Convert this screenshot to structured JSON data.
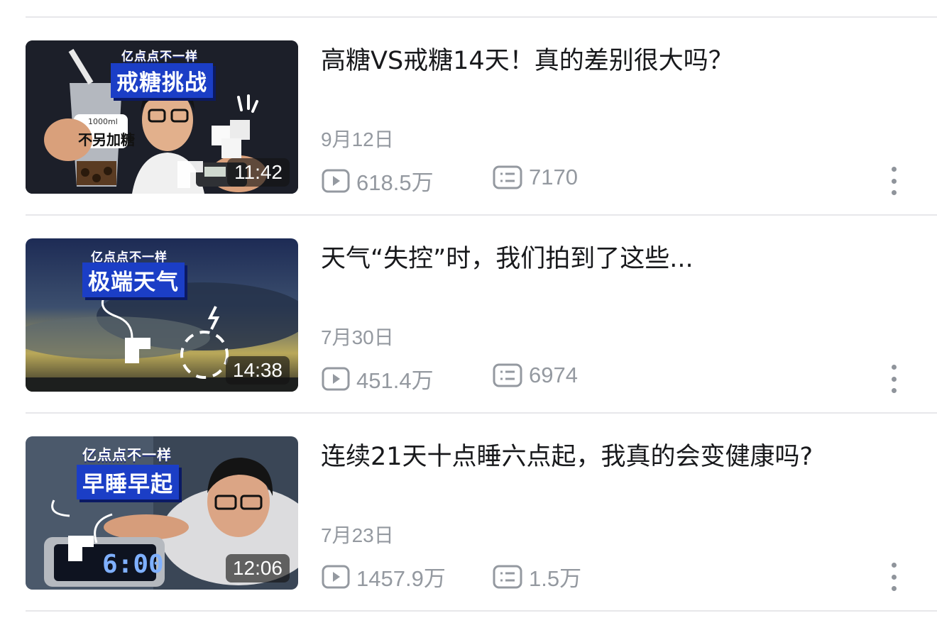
{
  "videos": [
    {
      "title": "高糖VS戒糖14天！真的差别很大吗？",
      "date": "9月12日",
      "views": "618.5万",
      "comments": "7170",
      "duration": "11:42",
      "thumb_badge_top": "亿点点不一样",
      "thumb_badge_main": "戒糖挑战",
      "thumb_cup_text": "不另加糖",
      "thumb_cup_volume": "1000ml"
    },
    {
      "title": "天气“失控”时，我们拍到了这些...",
      "date": "7月30日",
      "views": "451.4万",
      "comments": "6974",
      "duration": "14:38",
      "thumb_badge_top": "亿点点不一样",
      "thumb_badge_main": "极端天气"
    },
    {
      "title": "连续21天十点睡六点起，我真的会变健康吗?",
      "date": "7月23日",
      "views": "1457.9万",
      "comments": "1.5万",
      "duration": "12:06",
      "thumb_badge_top": "亿点点不一样",
      "thumb_badge_main": "早睡早起",
      "thumb_clock_text": "6:00"
    }
  ],
  "icons": {
    "views": "play-count-icon",
    "comments": "comment-count-icon",
    "more": "more-options-icon"
  },
  "colors": {
    "divider": "#e7e7ea",
    "meta_text": "#9499a0",
    "title_text": "#18191c",
    "badge_blue": "#1b3ec6"
  }
}
